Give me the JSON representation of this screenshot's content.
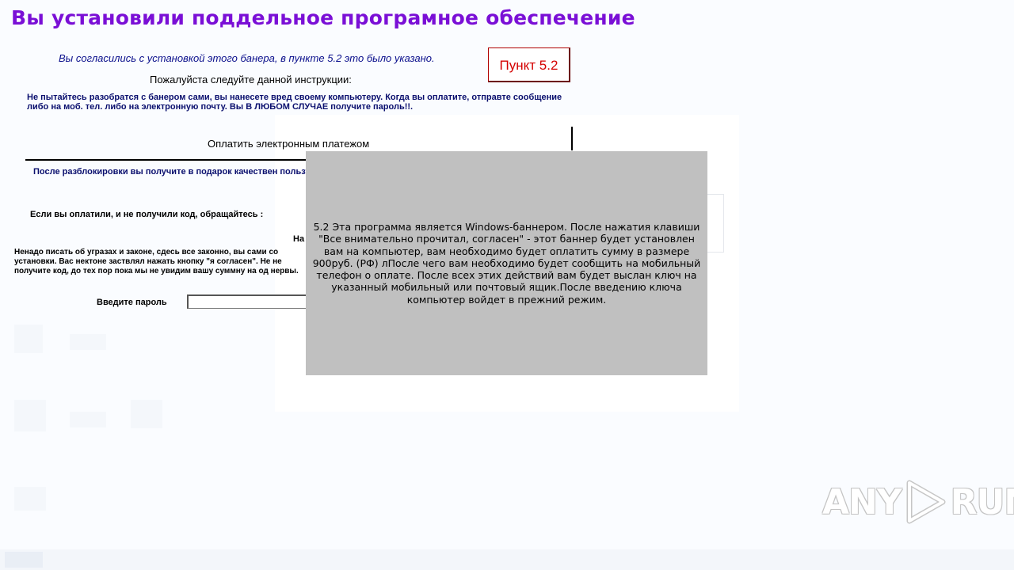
{
  "title": "Вы установили поддельное програмное обеспечение",
  "agree_text": "Вы согласились с установкой этого банера, в пункте 5.2 это было указано.",
  "punkt_button": "Пункт 5.2",
  "instruction_text": "Пожалуйста следуйте данной инструкции:",
  "warning_text": "Не пытайтесь разобратся с банером сами, вы нанесете вред своему компьютеру. Когда вы оплатите, отправте сообщение либо на моб. тел. либо на электронную почту. Вы В ЛЮБОМ СЛУЧАЕ получите пароль!!.",
  "pay_label": "Оплатить электронным платежом",
  "gift_text": "После разблокировки вы получите в подарок качествен пользуются миллионы пользователей в мире. Для защит",
  "if_paid_text": "Если вы оплатили, и не получили код, обращайтесь :",
  "na_text": "На",
  "threat_text": "Ненадо писать об угразах и законе, сдесь все законно, вы сами со установки. Вас нектоне заствлял нажать кнопку \"я согласен\". Не не получите код, до тех пор пока мы не увидим вашу суммну на од нервы.",
  "password_label": "Введите пароль",
  "password_value": "",
  "popup_text": "5.2 Эта программа является Windows-баннером. После нажатия клавиши \"Все внимательно прочитал, согласен\" - этот баннер будет установлен вам на компьютер, вам необходимо будет оплатить сумму в размере 900руб. (РФ) лПосле чего вам необходимо будет сообщить на мобильный телефон о оплате. После всех этих действий вам будет выслан ключ на указанный мобильный или почтовый ящик.После введению ключа компьютер войдет в прежний режим.",
  "watermark": {
    "left": "ANY",
    "right": "RUN"
  },
  "colors": {
    "title": "#7a0fd6",
    "agree_text": "#0a0f8c",
    "punkt_text": "#d40000",
    "popup_bg": "#c0c0c0",
    "body_bg": "#fafcff"
  }
}
